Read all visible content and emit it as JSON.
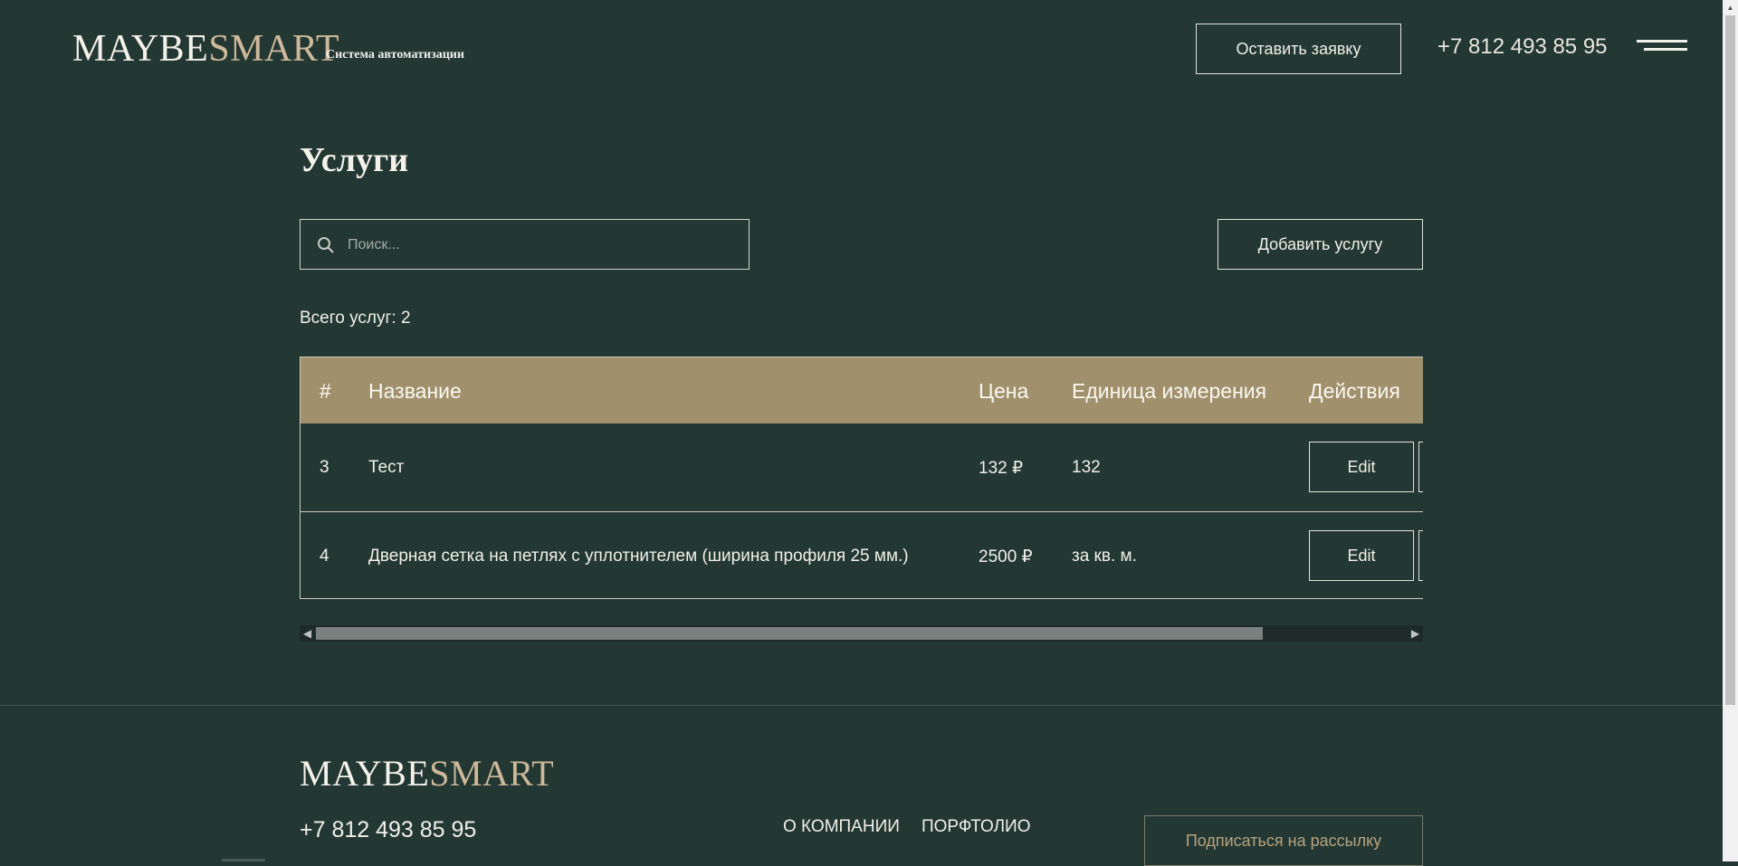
{
  "header": {
    "logo_part1": "MAYBE",
    "logo_part2": "SMART",
    "subtitle": "Система автоматизации",
    "request_button": "Оставить заявку",
    "phone": "+7 812 493 85 95",
    "menu_icon": "hamburger-icon"
  },
  "main": {
    "title": "Услуги",
    "search": {
      "placeholder": "Поиск...",
      "value": "",
      "icon": "search-icon"
    },
    "add_button": "Добавить услугу",
    "total_text": "Всего услуг: 2",
    "table": {
      "columns": [
        "#",
        "Название",
        "Цена",
        "Единица измерения",
        "Действия"
      ],
      "rows": [
        {
          "id": "3",
          "name": "Тест",
          "price": "132 ₽",
          "unit": "132",
          "edit": "Edit"
        },
        {
          "id": "4",
          "name": "Дверная сетка на петлях с уплотнителем (ширина профиля 25 мм.)",
          "price": "2500 ₽",
          "unit": "за кв. м.",
          "edit": "Edit"
        }
      ]
    }
  },
  "footer": {
    "logo_part1": "MAYBE",
    "logo_part2": "SMART",
    "phone": "+7 812 493 85 95",
    "links": [
      "О КОМПАНИИ",
      "ПОРФТОЛИО"
    ],
    "subscribe_button": "Подписаться на рассылку"
  },
  "colors": {
    "background": "#233833",
    "table_header": "#a0906c",
    "logo_accent": "#cdb89a",
    "subscribe_text": "#b7a37f"
  }
}
